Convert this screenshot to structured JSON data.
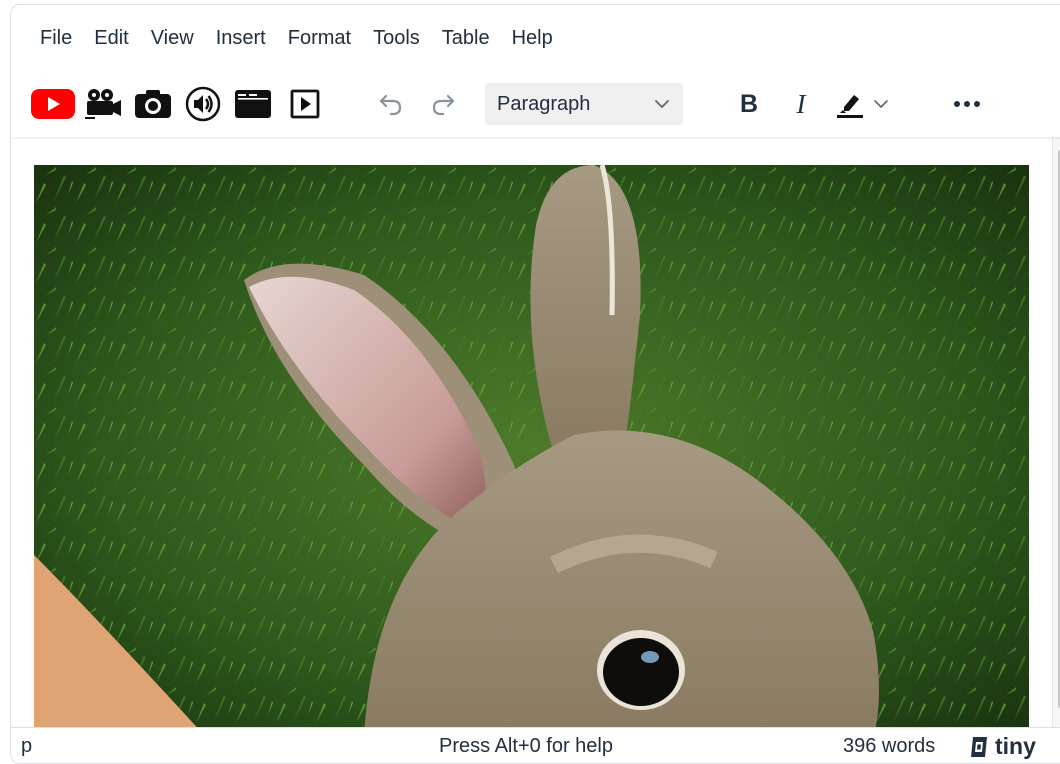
{
  "menubar": {
    "items": [
      "File",
      "Edit",
      "View",
      "Insert",
      "Format",
      "Tools",
      "Table",
      "Help"
    ]
  },
  "toolbar": {
    "buttons": [
      {
        "icon": "youtube-icon",
        "color": "#ff0000"
      },
      {
        "icon": "video-camera-icon"
      },
      {
        "icon": "camera-icon"
      },
      {
        "icon": "audio-icon"
      },
      {
        "icon": "window-icon"
      },
      {
        "icon": "play-icon"
      }
    ],
    "undo_icon": "undo-icon",
    "redo_icon": "redo-icon",
    "block_format": "Paragraph",
    "bold_label": "B",
    "italic_label": "I",
    "highlight_icon": "highlight-icon",
    "more_icon": "more-icon"
  },
  "content": {
    "image_subject": "rabbit-photo"
  },
  "statusbar": {
    "path": "p",
    "help_text": "Press Alt+0 for help",
    "word_count": "396 words",
    "brand": "tiny"
  }
}
